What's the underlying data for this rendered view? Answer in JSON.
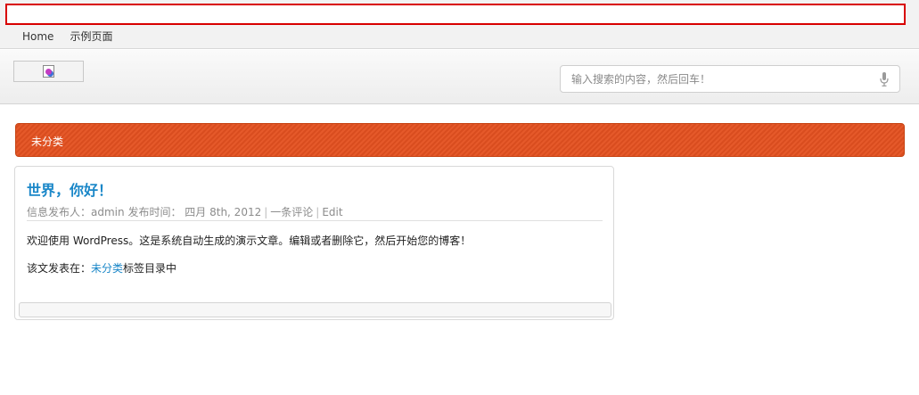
{
  "topnav": {
    "items": [
      {
        "label": "Home"
      },
      {
        "label": "示例页面"
      }
    ]
  },
  "header": {
    "logo_icon": "broken-image-icon",
    "search": {
      "placeholder": "输入搜索的内容，然后回车！",
      "value": "",
      "icon": "microphone-icon"
    }
  },
  "category": {
    "title": "未分类",
    "accent": "#e5592a"
  },
  "post": {
    "title": "世界，你好！",
    "author_label": "信息发布人：",
    "author": "admin",
    "date_label": "发布时间：",
    "date": "四月 8th, 2012",
    "comments": "一条评论",
    "edit": "Edit",
    "body": "欢迎使用 WordPress。这是系统自动生成的演示文章。编辑或者删除它，然后开始您的博客！",
    "footer_prefix": "该文发表在：",
    "footer_category": "未分类",
    "footer_suffix": "标签目录中",
    "title_color": "#1a87c8"
  }
}
